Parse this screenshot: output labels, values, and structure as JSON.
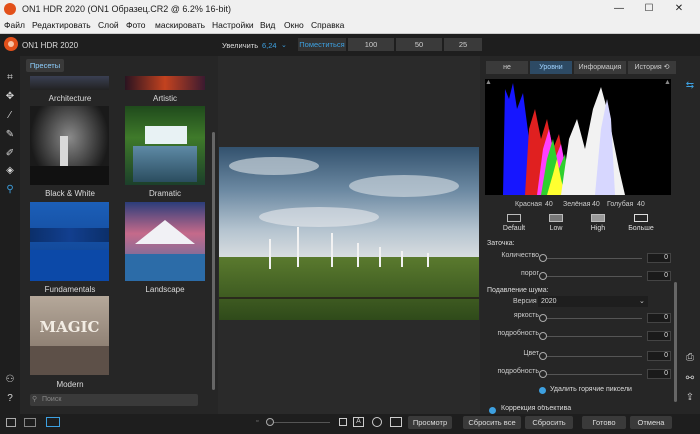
{
  "window": {
    "title": "ON1 HDR 2020 (ON1 Образец.CR2 @ 6.2% 16-bit)",
    "minimize": "—",
    "maximize": "☐",
    "close": "✕"
  },
  "menu": [
    "Файл",
    "Редактировать",
    "Слой",
    "Фото",
    "маскировать",
    "Настройки",
    "Вид",
    "Окно",
    "Справка"
  ],
  "app": {
    "name": "ON1 HDR 2020"
  },
  "zoom": {
    "label": "Увеличить",
    "value": "6,24",
    "fit": "Поместиться",
    "z100": "100",
    "z50": "50",
    "z25": "25"
  },
  "presets": {
    "tab": "Пресеты",
    "items": [
      {
        "label": "Architecture"
      },
      {
        "label": "Artistic"
      },
      {
        "label": "Black & White"
      },
      {
        "label": "Dramatic"
      },
      {
        "label": "Fundamentals"
      },
      {
        "label": "Landscape"
      },
      {
        "label": "Modern",
        "thumb_text": "MAGIC"
      }
    ],
    "search_placeholder": "Поиск"
  },
  "right_tabs": [
    "не",
    "Уровни",
    "Информация",
    "История ⟲"
  ],
  "histogram": {
    "red_label": "Красная",
    "red": "40",
    "green_label": "Зелёная",
    "green": "40",
    "blue_label": "Голубая",
    "blue": "40"
  },
  "hdr_presets": [
    "Default",
    "Low",
    "High",
    "Больше"
  ],
  "sharpen": {
    "title": "Заточка:",
    "amount_label": "Количество",
    "amount": "0",
    "threshold_label": "порог",
    "threshold": "0"
  },
  "noise": {
    "title": "Подавление шума:",
    "version_label": "Версия",
    "version": "2020",
    "lum_label": "яркость",
    "lum": "0",
    "lum_detail_label": "подробность",
    "lum_detail": "0",
    "color_label": "Цвет",
    "color": "0",
    "color_detail_label": "подробность",
    "color_detail": "0",
    "hot_pixels": "Удалить горячие пиксели"
  },
  "lens_section": "Коррекция объектива",
  "bottom": {
    "preview": "Просмотр",
    "reset_all": "Сбросить все",
    "reset": "Сбросить",
    "done": "Готово",
    "cancel": "Отмена"
  },
  "colors": {
    "accent": "#3da0e0",
    "brand": "#e2501a"
  }
}
